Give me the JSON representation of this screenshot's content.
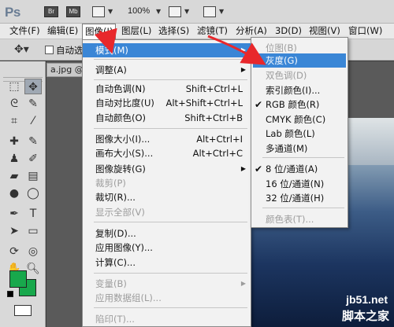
{
  "appbar": {
    "logo": "Ps",
    "btn_br": "Br",
    "btn_mb": "Mb",
    "zoom": "100%"
  },
  "menubar": [
    {
      "label": "文件(F)"
    },
    {
      "label": "编辑(E)"
    },
    {
      "label": "图像(I)"
    },
    {
      "label": "图层(L)"
    },
    {
      "label": "选择(S)"
    },
    {
      "label": "滤镜(T)"
    },
    {
      "label": "分析(A)"
    },
    {
      "label": "3D(D)"
    },
    {
      "label": "视图(V)"
    },
    {
      "label": "窗口(W)"
    }
  ],
  "options": {
    "auto_select_label": "自动选"
  },
  "document": {
    "tab_label": "a.jpg @"
  },
  "image_menu": {
    "items": [
      {
        "label": "模式(M)",
        "shortcut": "",
        "submenu": true,
        "highlighted": true,
        "disabled": false
      },
      {
        "label": "调整(A)",
        "shortcut": "",
        "submenu": true,
        "highlighted": false,
        "disabled": false
      },
      {
        "label": "自动色调(N)",
        "shortcut": "Shift+Ctrl+L",
        "submenu": false,
        "highlighted": false,
        "disabled": false
      },
      {
        "label": "自动对比度(U)",
        "shortcut": "Alt+Shift+Ctrl+L",
        "submenu": false,
        "highlighted": false,
        "disabled": false
      },
      {
        "label": "自动颜色(O)",
        "shortcut": "Shift+Ctrl+B",
        "submenu": false,
        "highlighted": false,
        "disabled": false
      },
      {
        "label": "图像大小(I)...",
        "shortcut": "Alt+Ctrl+I",
        "submenu": false,
        "highlighted": false,
        "disabled": false
      },
      {
        "label": "画布大小(S)...",
        "shortcut": "Alt+Ctrl+C",
        "submenu": false,
        "highlighted": false,
        "disabled": false
      },
      {
        "label": "图像旋转(G)",
        "shortcut": "",
        "submenu": true,
        "highlighted": false,
        "disabled": false
      },
      {
        "label": "裁剪(P)",
        "shortcut": "",
        "submenu": false,
        "highlighted": false,
        "disabled": true
      },
      {
        "label": "裁切(R)...",
        "shortcut": "",
        "submenu": false,
        "highlighted": false,
        "disabled": false
      },
      {
        "label": "显示全部(V)",
        "shortcut": "",
        "submenu": false,
        "highlighted": false,
        "disabled": true
      },
      {
        "label": "复制(D)...",
        "shortcut": "",
        "submenu": false,
        "highlighted": false,
        "disabled": false
      },
      {
        "label": "应用图像(Y)...",
        "shortcut": "",
        "submenu": false,
        "highlighted": false,
        "disabled": false
      },
      {
        "label": "计算(C)...",
        "shortcut": "",
        "submenu": false,
        "highlighted": false,
        "disabled": false
      },
      {
        "label": "变量(B)",
        "shortcut": "",
        "submenu": true,
        "highlighted": false,
        "disabled": true
      },
      {
        "label": "应用数据组(L)...",
        "shortcut": "",
        "submenu": false,
        "highlighted": false,
        "disabled": true
      },
      {
        "label": "陷印(T)...",
        "shortcut": "",
        "submenu": false,
        "highlighted": false,
        "disabled": true
      }
    ]
  },
  "mode_menu": {
    "items": [
      {
        "label": "位图(B)",
        "checked": false,
        "highlighted": false,
        "disabled": true
      },
      {
        "label": "灰度(G)",
        "checked": false,
        "highlighted": true,
        "disabled": false
      },
      {
        "label": "双色调(D)",
        "checked": false,
        "highlighted": false,
        "disabled": true
      },
      {
        "label": "索引颜色(I)...",
        "checked": false,
        "highlighted": false,
        "disabled": false
      },
      {
        "label": "RGB 颜色(R)",
        "checked": true,
        "highlighted": false,
        "disabled": false
      },
      {
        "label": "CMYK 颜色(C)",
        "checked": false,
        "highlighted": false,
        "disabled": false
      },
      {
        "label": "Lab 颜色(L)",
        "checked": false,
        "highlighted": false,
        "disabled": false
      },
      {
        "label": "多通道(M)",
        "checked": false,
        "highlighted": false,
        "disabled": false
      },
      {
        "label": "8 位/通道(A)",
        "checked": true,
        "highlighted": false,
        "disabled": false
      },
      {
        "label": "16 位/通道(N)",
        "checked": false,
        "highlighted": false,
        "disabled": false
      },
      {
        "label": "32 位/通道(H)",
        "checked": false,
        "highlighted": false,
        "disabled": false
      },
      {
        "label": "颜色表(T)...",
        "checked": false,
        "highlighted": false,
        "disabled": true
      }
    ]
  },
  "watermark": {
    "line1": "jb51.net",
    "line2": "脚本之家"
  },
  "colors": {
    "foreground": "#18a84c",
    "background": "#18a84c",
    "highlight": "#3a86d6",
    "annotation_arrow": "#e8282c"
  },
  "icons": [
    "move-tool-icon",
    "marquee-tool-icon",
    "lasso-tool-icon",
    "magic-wand-icon",
    "crop-tool-icon",
    "eyedropper-icon",
    "healing-brush-icon",
    "brush-icon",
    "clone-stamp-icon",
    "history-brush-icon",
    "eraser-icon",
    "gradient-icon",
    "blur-icon",
    "dodge-icon",
    "pen-tool-icon",
    "type-tool-icon",
    "path-select-icon",
    "shape-tool-icon",
    "3d-rotate-icon",
    "3d-orbit-icon",
    "hand-tool-icon",
    "zoom-tool-icon"
  ]
}
